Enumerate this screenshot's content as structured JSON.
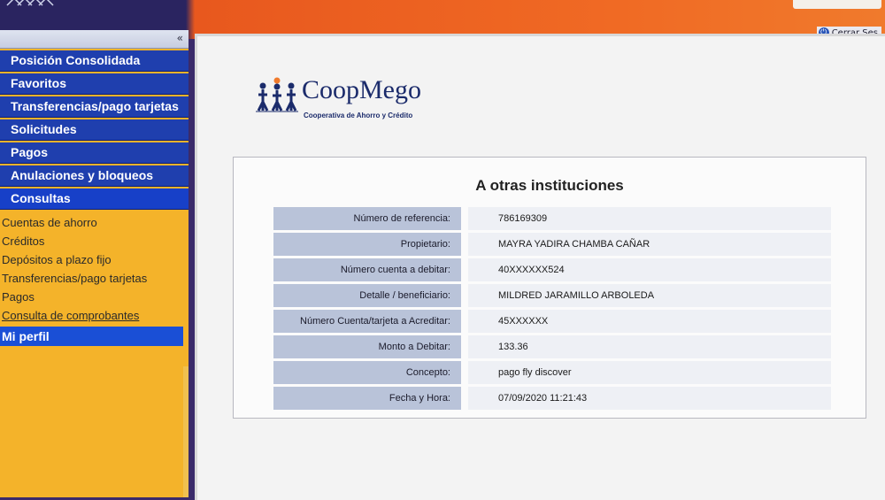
{
  "header": {
    "logout_label": "Cerrar Ses",
    "logout_icon": "power-icon"
  },
  "sidebar": {
    "collapse_icon": "double-chevron-left-icon",
    "menu": [
      {
        "label": "Posición Consolidada"
      },
      {
        "label": "Favoritos"
      },
      {
        "label": "Transferencias/pago tarjetas"
      },
      {
        "label": "Solicitudes"
      },
      {
        "label": "Pagos"
      },
      {
        "label": "Anulaciones y bloqueos"
      },
      {
        "label": "Consultas"
      }
    ],
    "submenu": [
      {
        "label": "Cuentas de ahorro"
      },
      {
        "label": "Créditos"
      },
      {
        "label": "Depósitos a plazo fijo"
      },
      {
        "label": "Transferencias/pago tarjetas"
      },
      {
        "label": "Pagos"
      },
      {
        "label": "Consulta de comprobantes"
      }
    ],
    "profile_label": "Mi perfil"
  },
  "logo": {
    "name": "CoopMego",
    "tagline": "Cooperativa de Ahorro y Crédito"
  },
  "receipt": {
    "title": "A otras instituciones",
    "rows": [
      {
        "label": "Número de referencia:",
        "value": "786169309"
      },
      {
        "label": "Propietario:",
        "value": "MAYRA YADIRA CHAMBA CAÑAR"
      },
      {
        "label": "Número cuenta a debitar:",
        "value": "40XXXXXX524"
      },
      {
        "label": "Detalle / beneficiario:",
        "value": "MILDRED JARAMILLO ARBOLEDA"
      },
      {
        "label": "Número Cuenta/tarjeta a Acreditar:",
        "value": "45XXXXXX"
      },
      {
        "label": "Monto a Debitar:",
        "value": "133.36"
      },
      {
        "label": "Concepto:",
        "value": "pago fly discover"
      },
      {
        "label": "Fecha y Hora:",
        "value": "07/09/2020 11:21:43"
      }
    ]
  },
  "colors": {
    "menu_blue": "#1f3fae",
    "sidebar_orange": "#f4b32a",
    "header_orange": "#f06a24",
    "label_bg": "#b9c3d9"
  }
}
